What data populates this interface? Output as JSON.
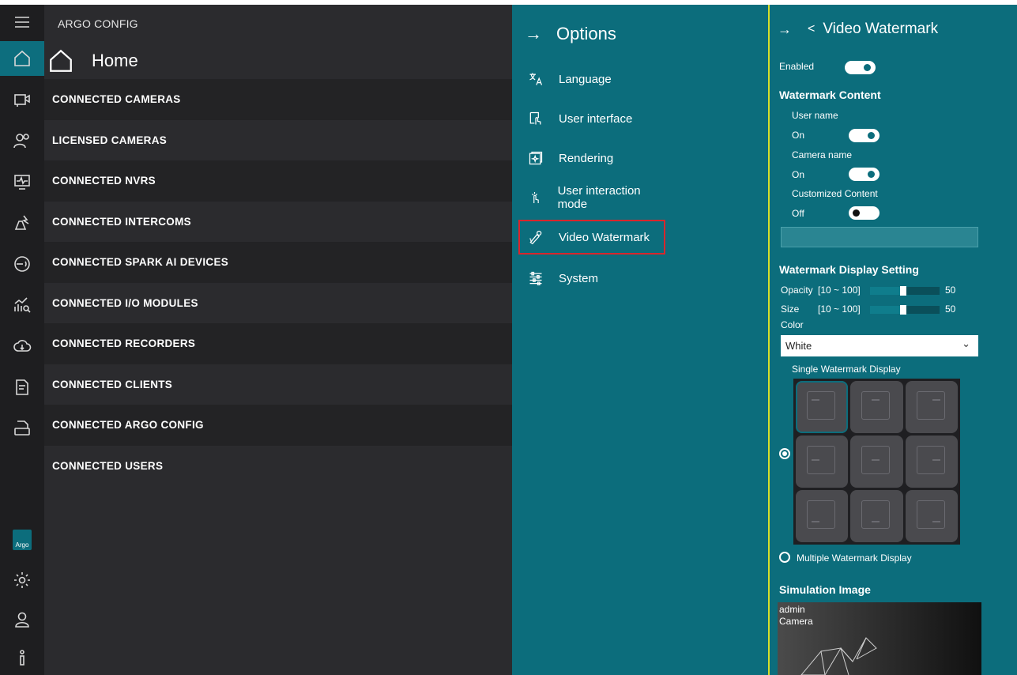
{
  "app": {
    "title": "ARGO CONFIG"
  },
  "rail": {
    "items": [
      {
        "icon": "hamburger-icon"
      },
      {
        "icon": "home-icon"
      },
      {
        "icon": "camera-icon"
      },
      {
        "icon": "users-icon"
      },
      {
        "icon": "monitor-icon"
      },
      {
        "icon": "intercom-icon"
      },
      {
        "icon": "spark-ai-icon"
      },
      {
        "icon": "io-module-icon"
      },
      {
        "icon": "cloud-icon"
      },
      {
        "icon": "client-doc-icon"
      },
      {
        "icon": "log-icon"
      },
      {
        "icon": "argo-logo"
      },
      {
        "icon": "gear-icon"
      },
      {
        "icon": "user-icon"
      },
      {
        "icon": "info-icon"
      }
    ],
    "argo_logo_text": "Argo"
  },
  "home": {
    "title": "Home",
    "items": [
      "CONNECTED CAMERAS",
      "LICENSED CAMERAS",
      "CONNECTED NVRS",
      "CONNECTED INTERCOMS",
      "CONNECTED SPARK AI DEVICES",
      "CONNECTED I/O MODULES",
      "CONNECTED RECORDERS",
      "CONNECTED CLIENTS",
      "CONNECTED ARGO CONFIG",
      "CONNECTED USERS"
    ]
  },
  "options": {
    "title": "Options",
    "items": [
      {
        "label": "Language",
        "icon": "translate-icon"
      },
      {
        "label": "User interface",
        "icon": "ui-touch-icon"
      },
      {
        "label": "Rendering",
        "icon": "rendering-icon"
      },
      {
        "label": "User interaction mode",
        "icon": "tap-icon"
      },
      {
        "label": "Video Watermark",
        "icon": "watermark-icon",
        "selected": true
      },
      {
        "label": "System",
        "icon": "sliders-icon"
      }
    ]
  },
  "watermark": {
    "title": "Video Watermark",
    "enabled_label": "Enabled",
    "enabled": true,
    "content_section": "Watermark Content",
    "user_name_label": "User name",
    "user_name_state": "On",
    "camera_name_label": "Camera name",
    "camera_name_state": "On",
    "custom_label": "Customized Content",
    "custom_state": "Off",
    "custom_value": "",
    "display_section": "Watermark Display Setting",
    "opacity_label": "Opacity",
    "opacity_range": "[10 ~ 100]",
    "opacity_value": "50",
    "size_label": "Size",
    "size_range": "[10 ~ 100]",
    "size_value": "50",
    "color_label": "Color",
    "color_value": "White",
    "single_label": "Single Watermark Display",
    "multiple_label": "Multiple Watermark Display",
    "display_mode": "single",
    "sim_section": "Simulation Image",
    "sim_line1": "admin",
    "sim_line2": "Camera"
  },
  "colors": {
    "teal": "#0c6d7c",
    "rail_bg": "#1e1e20",
    "main_bg": "#2b2b2e",
    "highlight_border": "#d9262c",
    "divider": "#d7e02a"
  }
}
